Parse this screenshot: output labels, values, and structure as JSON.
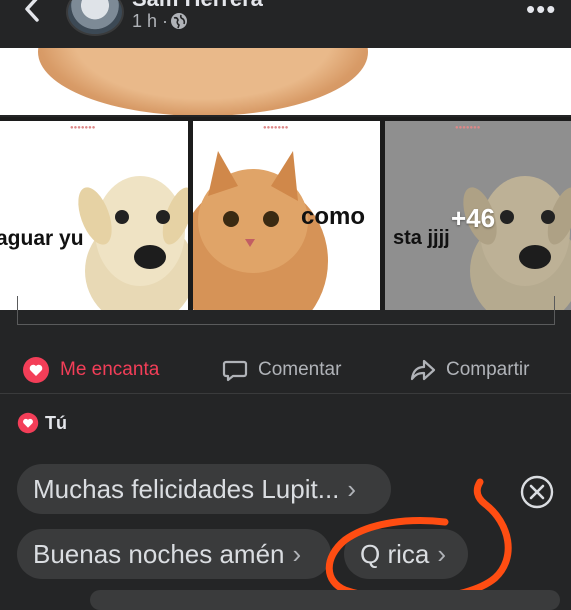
{
  "header": {
    "author_name": "Sam Herrera",
    "timestamp": "1 h ·"
  },
  "grid": {
    "cells": [
      {
        "text": "aguar yu"
      },
      {
        "text": "como"
      },
      {
        "text": "sta jjjj",
        "more_count": "+46"
      }
    ]
  },
  "actions": {
    "love_label": "Me encanta",
    "comment_label": "Comentar",
    "share_label": "Compartir",
    "love_color": "#f33e58"
  },
  "reactions": {
    "label": "Tú"
  },
  "quick_replies": {
    "items": [
      "Muchas felicidades Lupit...",
      "Buenas noches amén",
      "Q rica"
    ],
    "chevron": "›"
  },
  "icons": [
    "back-icon",
    "globe-icon",
    "more-icon",
    "heart-icon",
    "comment-icon",
    "share-icon",
    "close-circle-icon"
  ]
}
